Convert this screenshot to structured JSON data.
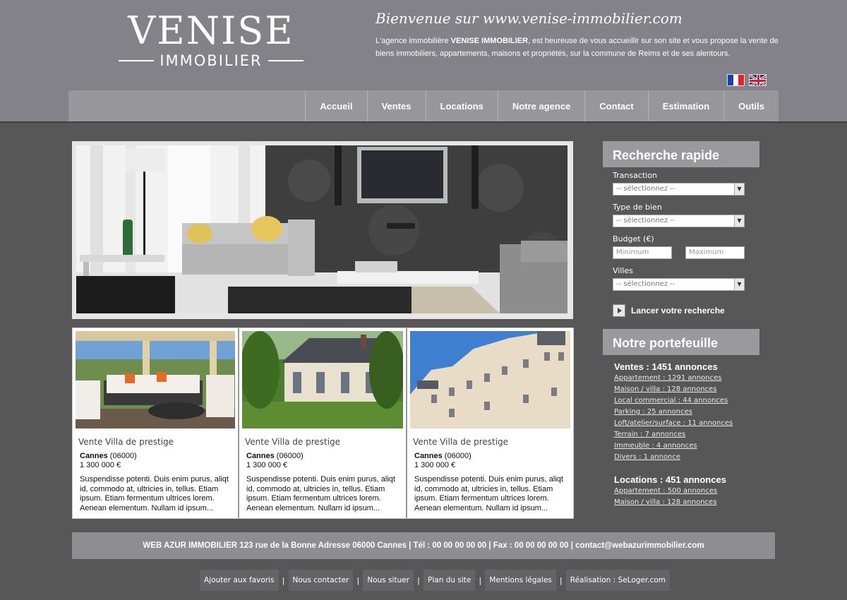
{
  "logo": {
    "main": "VENISE",
    "sub": "IMMOBILIER"
  },
  "welcome": {
    "title": "Bienvenue sur www.venise-immobilier.com",
    "text_before": "L'agence immobilière ",
    "text_bold": "VENISE IMMOBILIER",
    "text_after": ", est heureuse de vous accueillir sur son site et vous propose la vente de biens immobiliers, appartements, maisons et propriétés, sur la commune de Reims et de ses alentours."
  },
  "flags": [
    "french-flag",
    "english-flag"
  ],
  "nav": [
    "Accueil",
    "Ventes",
    "Locations",
    "Notre agence",
    "Contact",
    "Estimation",
    "Outils"
  ],
  "listings": [
    {
      "title": "Vente Villa de prestige",
      "city": "Cannes",
      "postcode": " (06000)",
      "price": "1 300 000 €",
      "desc": "Suspendisse potenti. Duis enim purus, aliqt id, commodo at, ultricies in, tellus. Etiam ipsum. Etiam fermentum ultrices lorem. Aenean elementum. Nullam id ipsum..."
    },
    {
      "title": "Vente Villa de prestige",
      "city": "Cannes",
      "postcode": " (06000)",
      "price": "1 300 000 €",
      "desc": "Suspendisse potenti. Duis enim purus, aliqt id, commodo at, ultricies in, tellus. Etiam ipsum. Etiam fermentum ultrices lorem. Aenean elementum. Nullam id ipsum..."
    },
    {
      "title": "Vente Villa de prestige",
      "city": "Cannes",
      "postcode": " (06000)",
      "price": "1 300 000 €",
      "desc": "Suspendisse potenti. Duis enim purus, aliqt id, commodo at, ultricies in, tellus. Etiam ipsum. Etiam fermentum ultrices lorem. Aenean elementum. Nullam id ipsum..."
    }
  ],
  "search": {
    "title": "Recherche rapide",
    "transaction_label": "Transaction",
    "transaction_value": "-- sélectionnez --",
    "type_label": "Type de bien",
    "type_value": "-- sélectionnez --",
    "budget_label": "Budget (€)",
    "min_placeholder": "Minimum",
    "max_placeholder": "Maximum",
    "city_label": "Villes",
    "city_value": "-- sélectionnez --",
    "button": "Lancer votre recherche"
  },
  "portfolio": {
    "title": "Notre portefeuille",
    "sales_title": "Ventes : 1451 annonces",
    "sales": [
      "Appartement : 1291 annonces",
      "Maison / villa : 128 annonces",
      "Local commercial : 44 annonces",
      "Parking : 25 annonces",
      "Loft/atelier/surface : 11 annonces",
      "Terrain : 7 annonces",
      "Immeuble : 4 annonces",
      "Divers : 1 annonce"
    ],
    "rentals_title": "Locations : 451 annonces",
    "rentals": [
      "Appartement : 500 annonces",
      "Maison / villa : 128 annonces"
    ]
  },
  "footer": {
    "address": "WEB AZUR IMMOBILIER   123 rue de la Bonne Adresse 06000 Cannes   |   Tél : 00 00 00 00 00   |   Fax : 00 00 00 00 00   |   contact@webazurimmobilier.com",
    "links": [
      "Ajouter aux favoris",
      "Nous contacter",
      "Nous situer",
      "Plan du site",
      "Mentions légales",
      "Réalisation : SeLoger.com"
    ]
  },
  "colors": {
    "background": "#575757",
    "header": "#828288",
    "nav": "#96969b",
    "sidebar_head": "#99999e",
    "footer_bar": "#8d8d92"
  }
}
